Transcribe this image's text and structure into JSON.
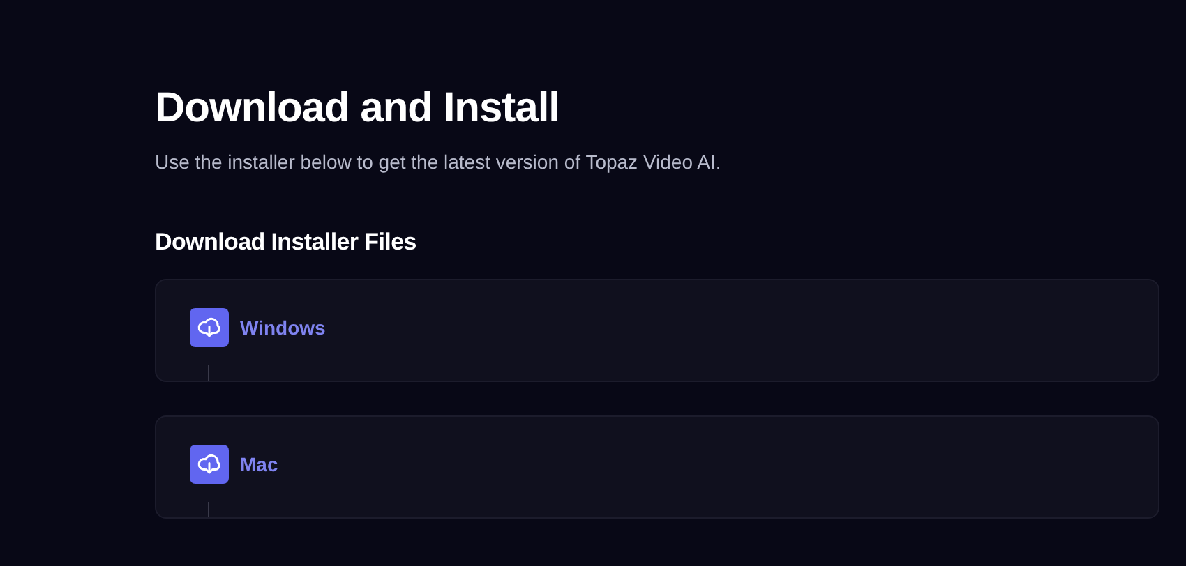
{
  "title": "Download and Install",
  "subtitle": "Use the installer below to get the latest version of Topaz Video AI.",
  "section": {
    "heading": "Download Installer Files",
    "items": [
      {
        "label": "Windows"
      },
      {
        "label": "Mac"
      }
    ]
  }
}
